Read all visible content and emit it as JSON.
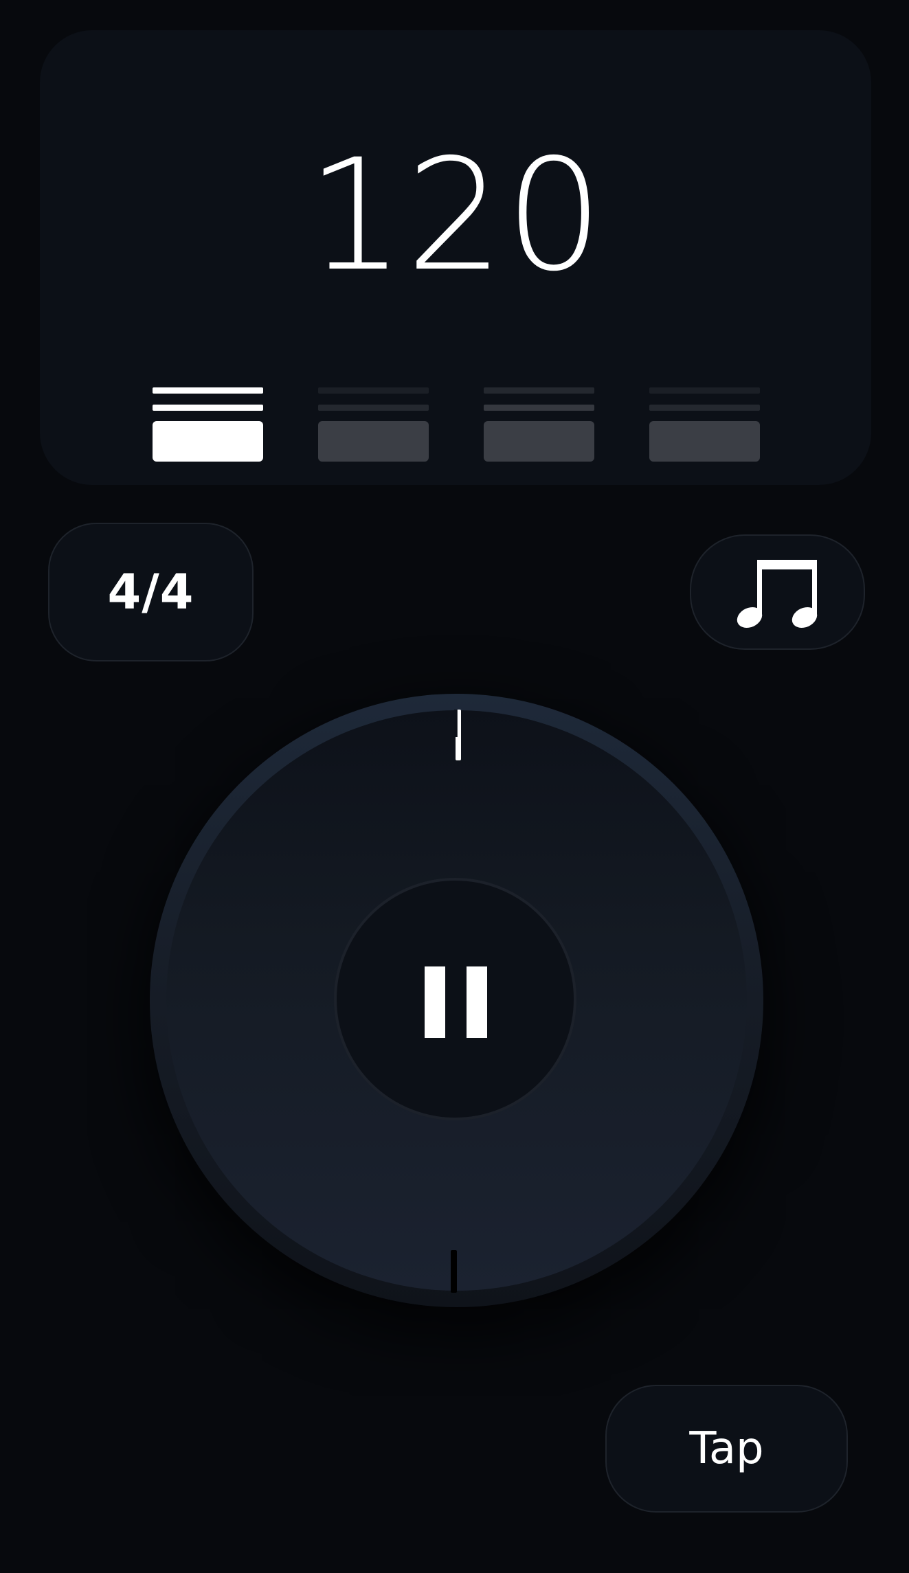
{
  "tempo": {
    "bpm": "120",
    "beats_per_bar": 4,
    "active_beat": 1
  },
  "controls": {
    "time_signature": "4/4",
    "sound_icon": "music-notes-icon",
    "play_state_icon": "pause-icon",
    "tap_label": "Tap"
  },
  "colors": {
    "background": "#07090d",
    "card": "#0c1017",
    "active_beat": "#ffffff",
    "inactive_beat": "#3b3e45",
    "dial_ring": "#1e2939"
  }
}
